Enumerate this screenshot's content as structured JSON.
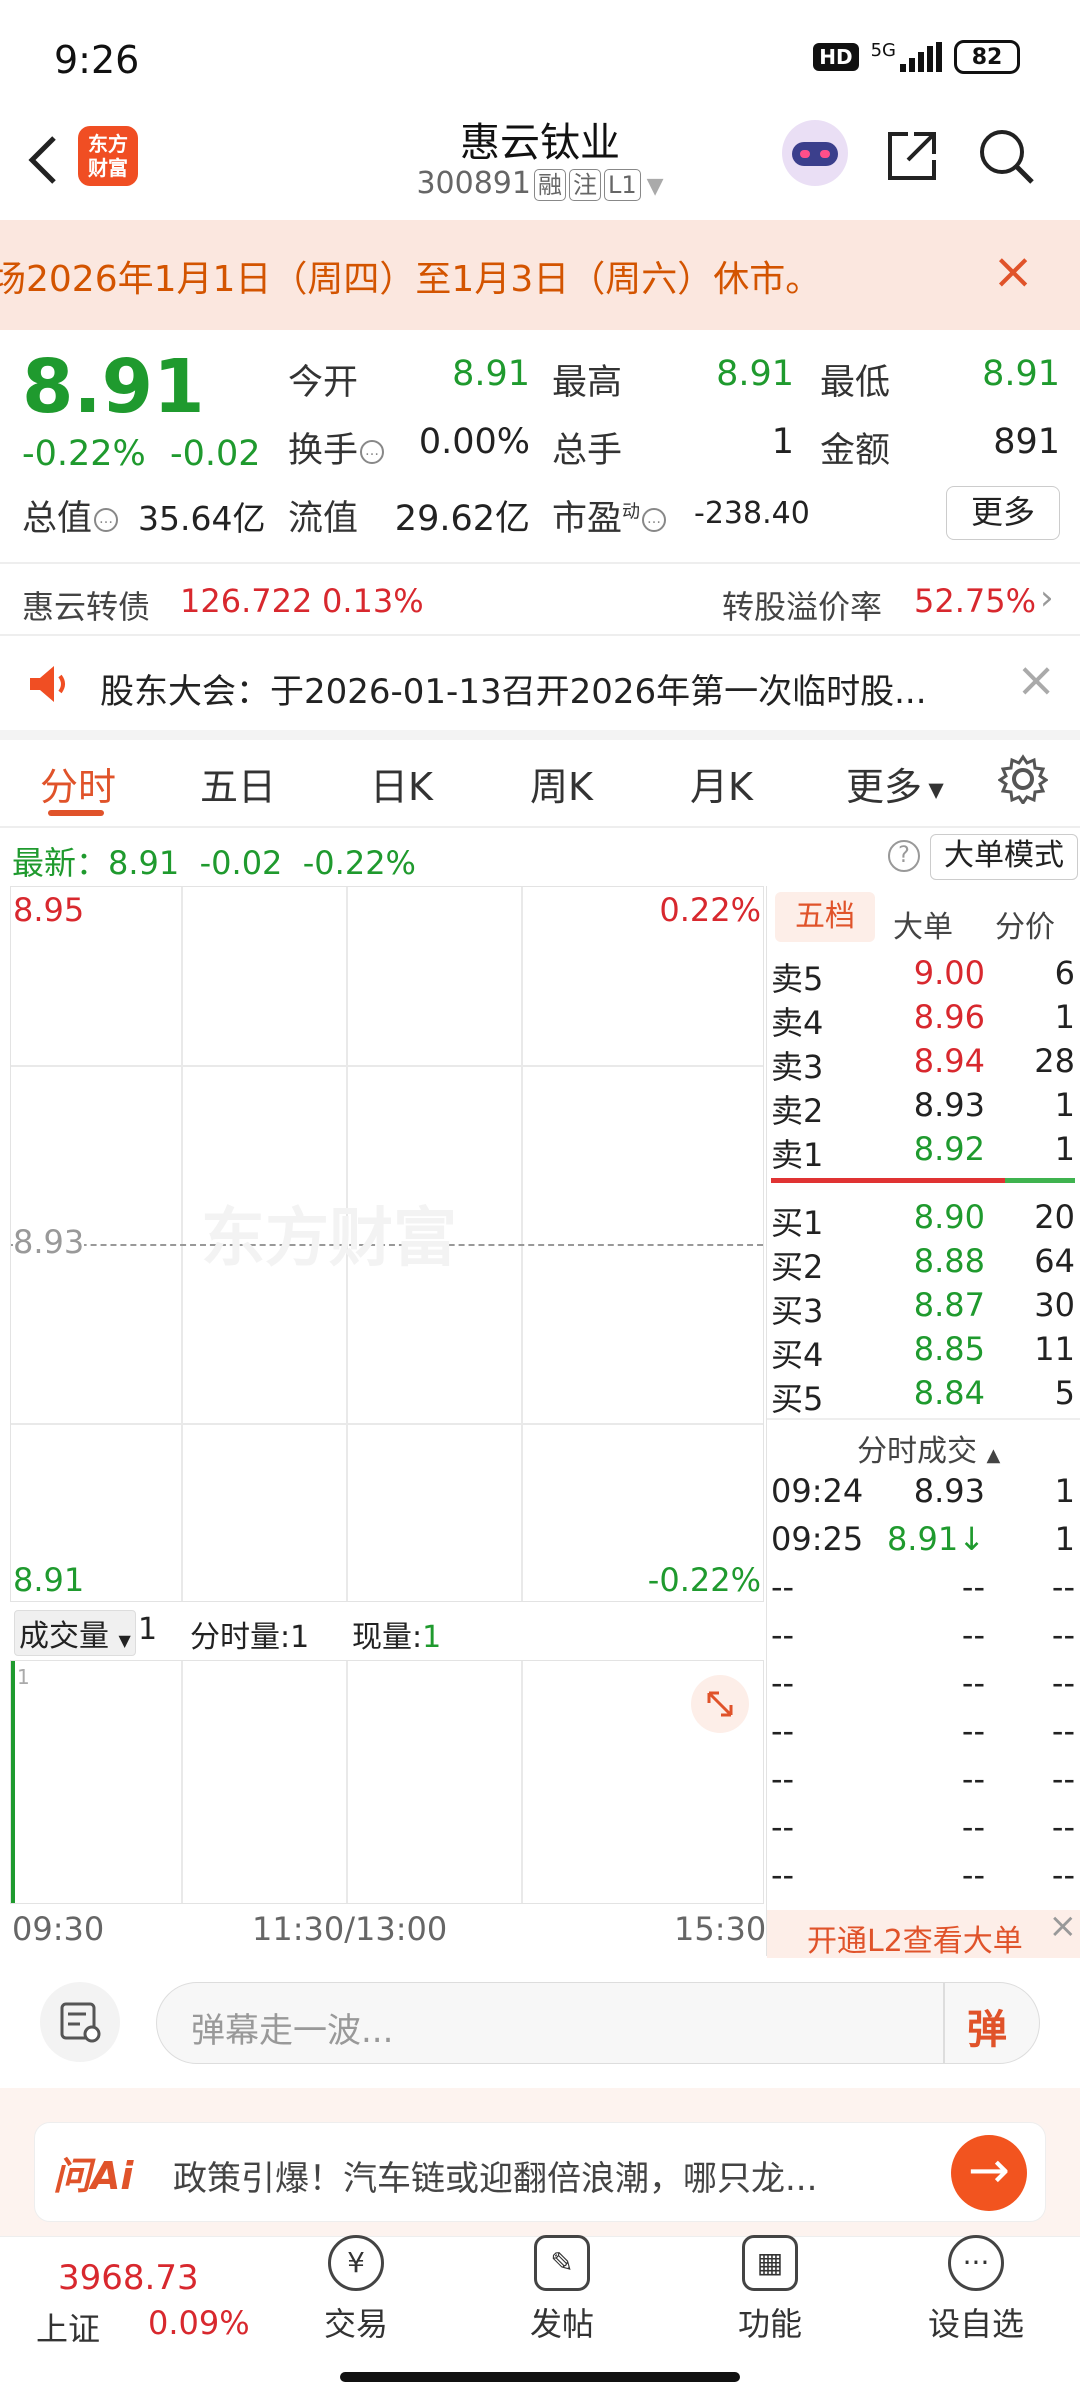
{
  "status": {
    "time": "9:26",
    "network": "5G",
    "hd": "HD",
    "battery": "82"
  },
  "header": {
    "logo_line1": "东方",
    "logo_line2": "财富",
    "name": "惠云钛业",
    "code": "300891",
    "tags": [
      "融",
      "注",
      "L1"
    ]
  },
  "banner": {
    "text": "场2026年1月1日（周四）至1月3日（周六）休市。"
  },
  "quote": {
    "price": "8.91",
    "change_pct": "-0.22%",
    "change": "-0.02",
    "open_label": "今开",
    "open": "8.91",
    "high_label": "最高",
    "high": "8.91",
    "low_label": "最低",
    "low": "8.91",
    "turnover_label": "换手",
    "turnover": "0.00%",
    "volume_label": "总手",
    "volume": "1",
    "amount_label": "金额",
    "amount": "891",
    "mcap_label": "总值",
    "mcap": "35.64亿",
    "float_label": "流值",
    "float": "29.62亿",
    "pe_label": "市盈",
    "pe_sup": "动",
    "pe": "-238.40",
    "more_label": "更多"
  },
  "bond": {
    "name": "惠云转债",
    "price": "126.722",
    "pct": "0.13%",
    "premium_label": "转股溢价率",
    "premium": "52.75%"
  },
  "notice": {
    "text": "股东大会：于2026-01-13召开2026年第一次临时股..."
  },
  "tabs": [
    "分时",
    "五日",
    "日K",
    "周K",
    "月K",
    "更多"
  ],
  "latest": {
    "label": "最新：",
    "price": "8.91",
    "change": "-0.02",
    "pct": "-0.22%",
    "mode": "大单模式"
  },
  "chart": {
    "y_top": "8.95",
    "y_mid": "8.93",
    "y_bot": "8.91",
    "pct_top": "0.22%",
    "pct_bot": "-0.22%",
    "watermark": "东方财富",
    "x_start": "09:30",
    "x_mid": "11:30/13:00",
    "x_end": "15:30",
    "vol_label": "成交量",
    "vol_val": "1",
    "fsvol_label": "分时量:1",
    "cur_label": "现量:",
    "cur_val": "1",
    "vol_axis": "1"
  },
  "book": {
    "tabs": [
      "五档",
      "大单",
      "分价"
    ],
    "asks": [
      {
        "l": "卖5",
        "p": "9.00",
        "v": "6",
        "c": "red"
      },
      {
        "l": "卖4",
        "p": "8.96",
        "v": "1",
        "c": "red"
      },
      {
        "l": "卖3",
        "p": "8.94",
        "v": "28",
        "c": "red"
      },
      {
        "l": "卖2",
        "p": "8.93",
        "v": "1",
        "c": "blk"
      },
      {
        "l": "卖1",
        "p": "8.92",
        "v": "1",
        "c": "grn"
      }
    ],
    "bids": [
      {
        "l": "买1",
        "p": "8.90",
        "v": "20",
        "c": "grn"
      },
      {
        "l": "买2",
        "p": "8.88",
        "v": "64",
        "c": "grn"
      },
      {
        "l": "买3",
        "p": "8.87",
        "v": "30",
        "c": "grn"
      },
      {
        "l": "买4",
        "p": "8.85",
        "v": "11",
        "c": "grn"
      },
      {
        "l": "买5",
        "p": "8.84",
        "v": "5",
        "c": "grn"
      }
    ],
    "trades_title": "分时成交",
    "trades": [
      {
        "t": "09:24",
        "p": "8.93",
        "v": "1",
        "c": "blk"
      },
      {
        "t": "09:25",
        "p": "8.91↓",
        "v": "1",
        "c": "grn"
      }
    ],
    "empty": "--",
    "l2": "开通L2查看大单"
  },
  "danmu": {
    "placeholder": "弹幕走一波...",
    "btn": "弹"
  },
  "ai": {
    "logo": "问Ai",
    "text": "政策引爆！汽车链或迎翻倍浪潮，哪只龙..."
  },
  "bottom": {
    "index_val": "3968.73",
    "index_name": "上证",
    "index_pct": "0.09%",
    "trade": "交易",
    "post": "发帖",
    "func": "功能",
    "watch": "设自选"
  }
}
